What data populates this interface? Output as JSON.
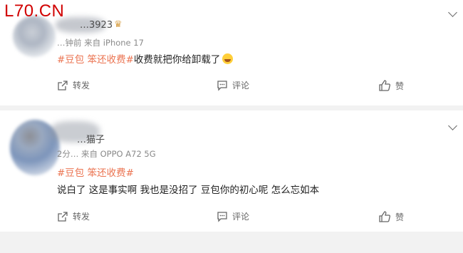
{
  "watermark": "L70.CN",
  "comments": [
    {
      "username": "…3923",
      "meta": "…钟前 来自 iPhone 17",
      "tags": "#豆包 笨还收费#",
      "text": "收费就把你给卸载了",
      "actions": {
        "forward": "转发",
        "comment": "评论",
        "like": "赞"
      }
    },
    {
      "username": "…猫子",
      "meta": "2分… 来自 OPPO A72 5G",
      "tags": "#豆包 笨还收费#",
      "text": "说白了 这是事实啊 我也是没招了 豆包你的初心呢 怎么忘如本",
      "actions": {
        "forward": "转发",
        "comment": "评论",
        "like": "赞"
      }
    }
  ],
  "colors": {
    "tag": "#eb7350",
    "watermark": "#d10000",
    "text": "#222222",
    "muted": "#8a8a8a"
  },
  "icons": [
    "expand-chevron-icon",
    "forward-icon",
    "comment-icon",
    "like-icon",
    "laughing-emoji-icon",
    "crown-icon"
  ]
}
